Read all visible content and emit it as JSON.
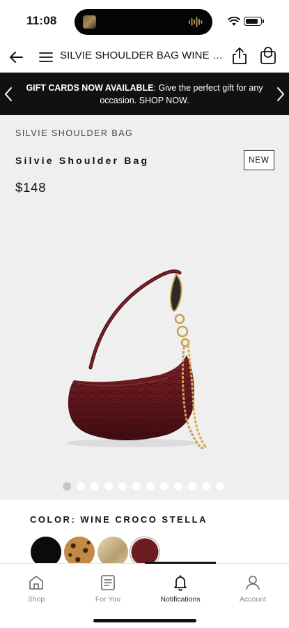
{
  "status_bar": {
    "time": "11:08",
    "battery_level": 0.85
  },
  "nav": {
    "title": "SILVIE SHOULDER BAG WINE CR..."
  },
  "promo": {
    "bold": "GIFT CARDS NOW AVAILABLE",
    "rest": ": Give the perfect gift for any occasion. SHOP NOW."
  },
  "product": {
    "kicker": "SILVIE SHOULDER BAG",
    "name": "Silvie Shoulder Bag",
    "badge": "NEW",
    "price": "$148",
    "image_count": 12,
    "active_image": 1
  },
  "colors": {
    "label": "COLOR: WINE CROCO STELLA",
    "swatches": [
      {
        "name": "black",
        "color": "#0b0b0b"
      },
      {
        "name": "leopard",
        "color": "#b07a3a"
      },
      {
        "name": "gold",
        "color": "#c9b78f"
      },
      {
        "name": "wine croco",
        "color": "#6b1d22",
        "selected": true
      }
    ]
  },
  "tabs": [
    {
      "label": "Shop",
      "icon": "shop-icon"
    },
    {
      "label": "For You",
      "icon": "for-you-icon"
    },
    {
      "label": "Notifications",
      "icon": "bell-icon",
      "active": true
    },
    {
      "label": "Account",
      "icon": "account-icon"
    }
  ]
}
